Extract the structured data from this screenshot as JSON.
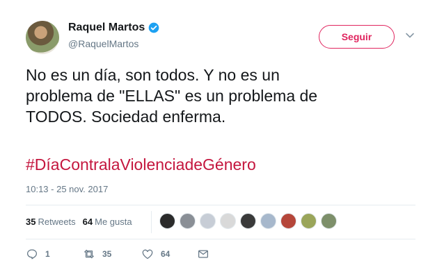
{
  "author": {
    "name": "Raquel Martos",
    "handle": "@RaquelMartos",
    "verified": true
  },
  "follow_button": {
    "label": "Seguir"
  },
  "tweet": {
    "text_lines": [
      "No es un día, son todos. Y no es un",
      "problema de \"ELLAS\" es un problema de",
      "TODOS. Sociedad enferma."
    ],
    "hashtag": "#DíaContralaViolenciadeGénero",
    "timestamp": "10:13 - 25 nov. 2017"
  },
  "stats": {
    "retweets_count": "35",
    "retweets_label": "Retweets",
    "likes_count": "64",
    "likes_label": "Me gusta"
  },
  "liker_avatars": [
    {
      "name": "liker-1",
      "color": "#2b2b2b"
    },
    {
      "name": "liker-2",
      "color": "#8a8f96"
    },
    {
      "name": "liker-3",
      "color": "#c7cdd6"
    },
    {
      "name": "liker-4",
      "color": "#d9d9d9"
    },
    {
      "name": "liker-5",
      "color": "#3a3a3a"
    },
    {
      "name": "liker-6",
      "color": "#a7b8cc"
    },
    {
      "name": "liker-7",
      "color": "#b5463a"
    },
    {
      "name": "liker-8",
      "color": "#9aa55a"
    },
    {
      "name": "liker-9",
      "color": "#7d8f6a"
    }
  ],
  "actions": {
    "reply_count": "1",
    "retweet_count": "35",
    "like_count": "64"
  },
  "colors": {
    "accent": "#e0245e",
    "hashtag": "#c4163e",
    "verified": "#1da1f2",
    "muted": "#657786"
  }
}
